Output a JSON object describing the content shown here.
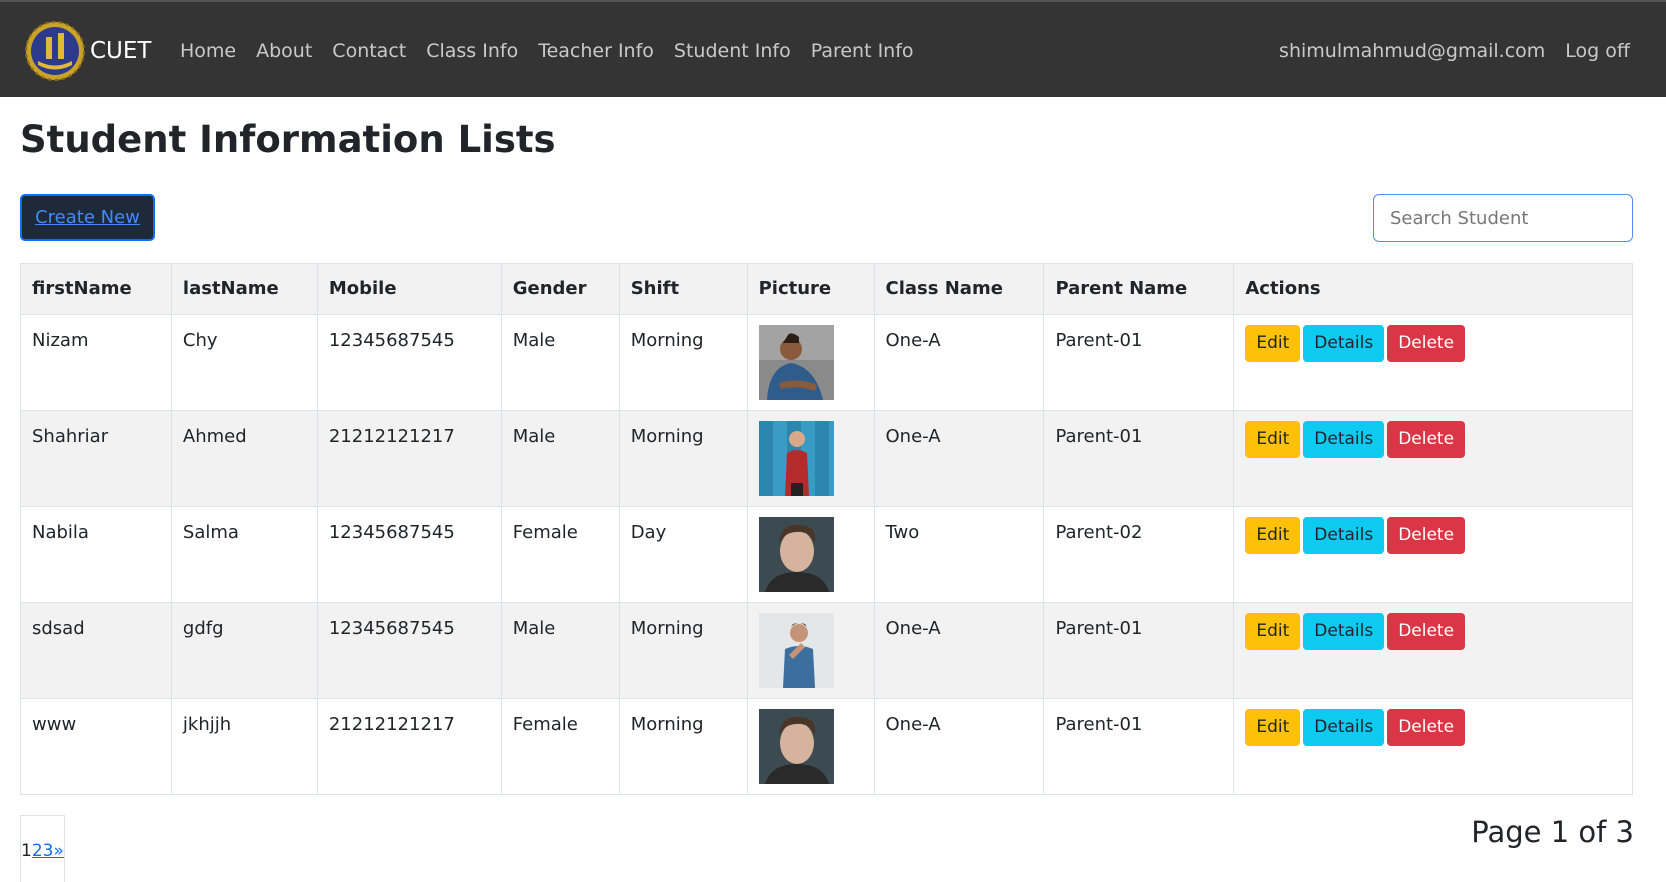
{
  "navbar": {
    "brand": "CUET",
    "links": [
      "Home",
      "About",
      "Contact",
      "Class Info",
      "Teacher Info",
      "Student Info",
      "Parent Info"
    ],
    "user_email": "shimulmahmud@gmail.com",
    "logoff": "Log off"
  },
  "page": {
    "title": "Student Information Lists",
    "create_label": "Create New",
    "search_placeholder": "Search Student"
  },
  "table": {
    "headers": [
      "firstName",
      "lastName",
      "Mobile",
      "Gender",
      "Shift",
      "Picture",
      "Class Name",
      "Parent Name",
      "Actions"
    ],
    "rows": [
      {
        "firstName": "Nizam",
        "lastName": "Chy",
        "mobile": "12345687545",
        "gender": "Male",
        "shift": "Morning",
        "className": "One-A",
        "parentName": "Parent-01"
      },
      {
        "firstName": "Shahriar",
        "lastName": "Ahmed",
        "mobile": "21212121217",
        "gender": "Male",
        "shift": "Morning",
        "className": "One-A",
        "parentName": "Parent-01"
      },
      {
        "firstName": "Nabila",
        "lastName": "Salma",
        "mobile": "12345687545",
        "gender": "Female",
        "shift": "Day",
        "className": "Two",
        "parentName": "Parent-02"
      },
      {
        "firstName": "sdsad",
        "lastName": "gdfg",
        "mobile": "12345687545",
        "gender": "Male",
        "shift": "Morning",
        "className": "One-A",
        "parentName": "Parent-01"
      },
      {
        "firstName": "www",
        "lastName": "jkhjjh",
        "mobile": "21212121217",
        "gender": "Female",
        "shift": "Morning",
        "className": "One-A",
        "parentName": "Parent-01"
      }
    ],
    "actions": {
      "edit": "Edit",
      "details": "Details",
      "delete": "Delete"
    }
  },
  "pagination": {
    "current": "1",
    "pages": [
      "2",
      "3"
    ],
    "next": "»",
    "info": "Page 1 of 3"
  },
  "colors": {
    "navbar": "#343434",
    "edit": "#ffc107",
    "details": "#0dcaf0",
    "delete": "#dc3545",
    "link": "#0d6efd"
  }
}
